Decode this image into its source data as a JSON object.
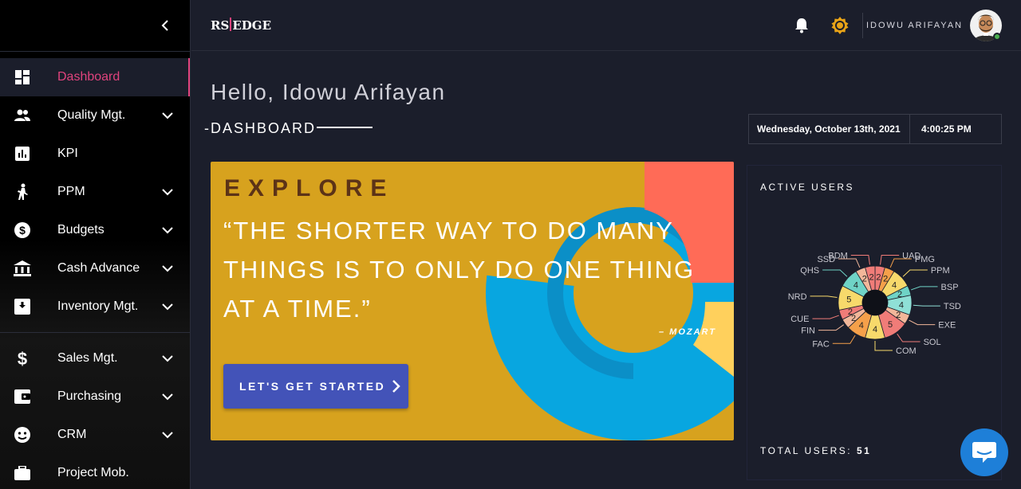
{
  "header": {
    "logo_left": "RS",
    "logo_right": "EDGE",
    "user_name": "IDOWU ARIFAYAN"
  },
  "sidebar": {
    "items": [
      {
        "label": "Dashboard",
        "icon": "dashboard-icon",
        "active": true
      },
      {
        "label": "Quality Mgt.",
        "icon": "people-icon",
        "expandable": true
      },
      {
        "label": "KPI",
        "icon": "chart-icon"
      },
      {
        "label": "PPM",
        "icon": "person-icon",
        "expandable": true
      },
      {
        "label": "Budgets",
        "icon": "dollar-circle-icon",
        "expandable": true
      },
      {
        "label": "Cash Advance",
        "icon": "bank-icon",
        "expandable": true
      },
      {
        "label": "Inventory Mgt.",
        "icon": "archive-icon",
        "expandable": true
      },
      {
        "label": "Sales Mgt.",
        "icon": "dollar-icon",
        "expandable": true
      },
      {
        "label": "Purchasing",
        "icon": "wallet-icon",
        "expandable": true
      },
      {
        "label": "CRM",
        "icon": "face-icon",
        "expandable": true
      },
      {
        "label": "Project Mob.",
        "icon": "briefcase-icon"
      }
    ]
  },
  "main": {
    "greeting": "Hello, Idowu Arifayan",
    "subtitle": "-DASHBOARD",
    "date": "Wednesday, October 13th, 2021",
    "time": "4:00:25 PM",
    "banner": {
      "heading": "EXPLORE",
      "quote": "“THE SHORTER WAY TO DO MANY THINGS IS TO ONLY DO ONE THING AT A TIME.”",
      "author": "– MOZART",
      "cta_label": "LET'S GET STARTED"
    }
  },
  "active_users": {
    "title": "ACTIVE USERS",
    "total_label": "TOTAL USERS:",
    "total_value": "51"
  },
  "chart_data": {
    "type": "pie",
    "variant": "donut",
    "categories": [
      "UAD",
      "PMG",
      "PPM",
      "BSP",
      "TSD",
      "EXE",
      "SOL",
      "COM",
      "FAC",
      "FIN",
      "CUE",
      "NRD",
      "QHS",
      "SSD",
      "BDM"
    ],
    "values": [
      2,
      2,
      4,
      2,
      4,
      2,
      5,
      4,
      4,
      2,
      2,
      5,
      4,
      2,
      2
    ],
    "colors": [
      "#f07c78",
      "#f5a04a",
      "#f7d96b",
      "#6fd3c6",
      "#8fe0d6",
      "#f2b79a",
      "#f07c78",
      "#f7d96b",
      "#f5a04a",
      "#f2b79a",
      "#f07c78",
      "#f7d96b",
      "#6fd3c6",
      "#f2b79a",
      "#f07c78"
    ]
  },
  "colors": {
    "accent": "#e0437d",
    "banner_bg": "#d7a21e",
    "cta_bg": "#4353b8",
    "chat_bg": "#1e7fd8",
    "page_bg": "#1b1e2b"
  }
}
